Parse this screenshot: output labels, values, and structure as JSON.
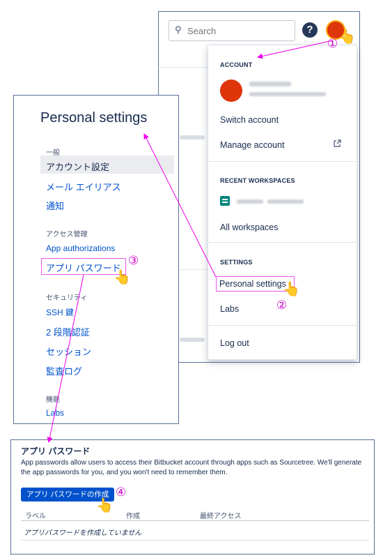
{
  "header": {
    "search_placeholder": "Search",
    "help_icon": "?",
    "avatar_icon": "user-avatar"
  },
  "dropdown": {
    "account_header": "ACCOUNT",
    "switch_account": "Switch account",
    "manage_account": "Manage account",
    "recent_header": "RECENT WORKSPACES",
    "all_workspaces": "All workspaces",
    "settings_header": "SETTINGS",
    "personal_settings": "Personal settings",
    "labs": "Labs",
    "log_out": "Log out",
    "external_icon": "external-link-icon"
  },
  "settings": {
    "title": "Personal settings",
    "groups": [
      {
        "heading": "一般",
        "items": [
          "アカウント設定",
          "メール エイリアス",
          "通知"
        ]
      },
      {
        "heading": "アクセス管理",
        "items": [
          "App authorizations",
          "アプリ パスワード"
        ]
      },
      {
        "heading": "セキュリティ",
        "items": [
          "SSH 鍵",
          "2 段階認証",
          "セッション",
          "監査ログ"
        ]
      },
      {
        "heading": "機能",
        "items": [
          "Labs"
        ]
      }
    ]
  },
  "app_passwords": {
    "title": "アプリ パスワード",
    "description": "App passwords allow users to access their Bitbucket account through apps such as Sourcetree. We'll generate the app passwords for you, and you won't need to remember them.",
    "create_button": "アプリ パスワードの作成",
    "columns": [
      "ラベル",
      "作成",
      "最終アクセス"
    ],
    "empty": "アプリパスワードを作成していません"
  },
  "annotations": {
    "step1": "①",
    "step2": "②",
    "step3": "③",
    "step4": "④",
    "hand": "👆"
  },
  "colors": {
    "accent": "#0052cc",
    "annotation": "#ee00ee",
    "avatar": "#de350b"
  }
}
